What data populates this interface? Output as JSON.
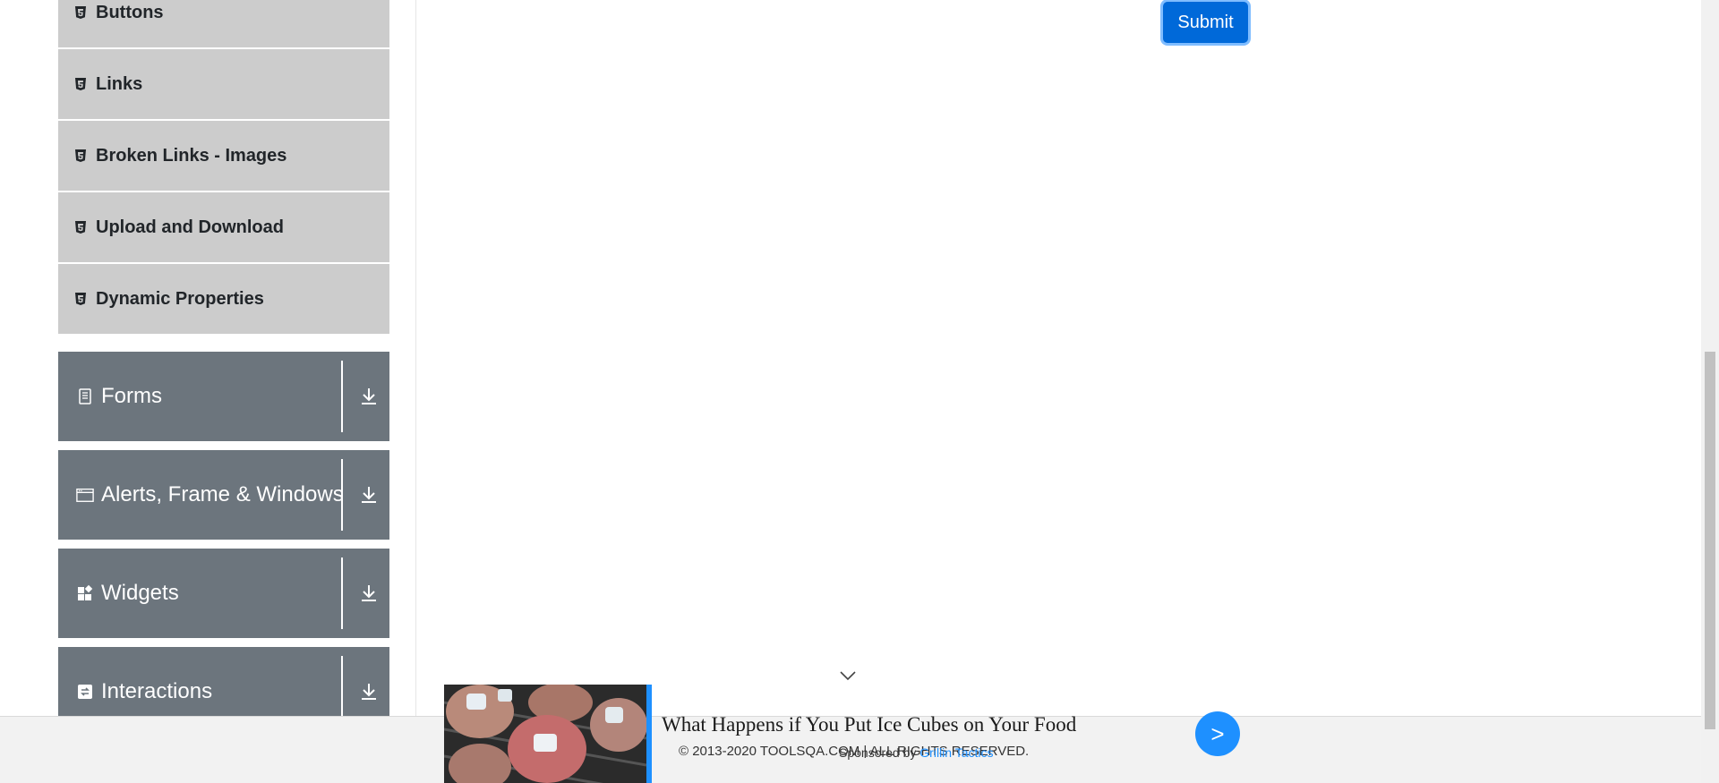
{
  "sidebar": {
    "elements_items": [
      {
        "label": "Buttons",
        "icon": "html5-icon"
      },
      {
        "label": "Links",
        "icon": "html5-icon"
      },
      {
        "label": "Broken Links - Images",
        "icon": "html5-icon"
      },
      {
        "label": "Upload and Download",
        "icon": "html5-icon"
      },
      {
        "label": "Dynamic Properties",
        "icon": "html5-icon"
      }
    ],
    "groups": [
      {
        "label": "Forms",
        "icon": "form-document-icon",
        "expand_icon": "download-arrow-icon"
      },
      {
        "label": "Alerts, Frame & Windows",
        "icon": "browser-window-icon",
        "expand_icon": "download-arrow-icon"
      },
      {
        "label": "Widgets",
        "icon": "widgets-icon",
        "expand_icon": "download-arrow-icon"
      },
      {
        "label": "Interactions",
        "icon": "interactions-icon",
        "expand_icon": "download-arrow-icon"
      }
    ]
  },
  "main": {
    "submit_label": "Submit"
  },
  "ad": {
    "headline": "What Happens if You Put Ice Cubes on Your Food",
    "sponsored_prefix": "Sponsored by",
    "sponsor_name": "Grillin Tactics",
    "arrow_label": ">"
  },
  "footer": {
    "copyright": "© 2013-2020 TOOLSQA.COM | ALL RIGHTS RESERVED."
  },
  "colors": {
    "submit": "#0069d9",
    "sidebar_item_bg": "#cccccc",
    "group_bg": "#6c757d",
    "ad_accent": "#1e90ff"
  }
}
